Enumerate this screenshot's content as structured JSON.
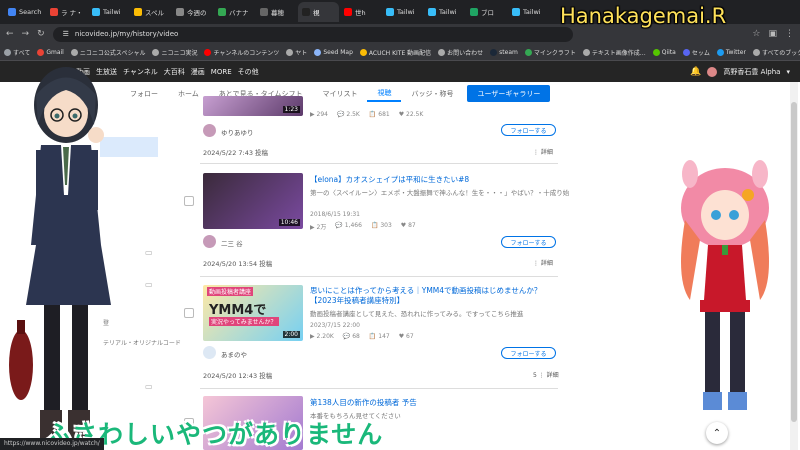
{
  "browser": {
    "tabs": [
      {
        "label": "Search",
        "color": "#4285f4"
      },
      {
        "label": "ラ ナ・",
        "color": "#ea4335"
      },
      {
        "label": "Tailwi",
        "color": "#38bdf8"
      },
      {
        "label": "スペル",
        "color": "#fbbc05"
      },
      {
        "label": "今週の",
        "color": "#888888"
      },
      {
        "label": "バナナ",
        "color": "#34a853"
      },
      {
        "label": "暮穂 ",
        "color": "#666666"
      },
      {
        "label": "視",
        "color": "#222222",
        "active": true
      },
      {
        "label": "世h",
        "color": "#ff0000"
      },
      {
        "label": "Tailwi",
        "color": "#38bdf8"
      },
      {
        "label": "Tailwi",
        "color": "#38bdf8"
      },
      {
        "label": "ブロ",
        "color": "#1fa463"
      },
      {
        "label": "Tailwi",
        "color": "#38bdf8"
      }
    ],
    "url": "nicovideo.jp/my/history/video",
    "bookmarks": [
      {
        "label": "すべて",
        "color": "#9aa0a6"
      },
      {
        "label": "Gmail",
        "color": "#ea4335"
      },
      {
        "label": "ニコニコ公式スペシャル",
        "color": "#aaaaaa"
      },
      {
        "label": "ニコニコ実況",
        "color": "#aaaaaa"
      },
      {
        "label": "チャンネルのコンテンツ",
        "color": "#ff0000"
      },
      {
        "label": "ヤト",
        "color": "#aaaaaa"
      },
      {
        "label": "Seed Map",
        "color": "#8ab4f8"
      },
      {
        "label": "ACUCH KITE 動画配信",
        "color": "#fbbc05"
      },
      {
        "label": "お問い合わせ",
        "color": "#aaaaaa"
      },
      {
        "label": "steam",
        "color": "#1b2838"
      },
      {
        "label": "マインクラフト",
        "color": "#34a853"
      },
      {
        "label": "テキスト画像作成…",
        "color": "#aaaaaa"
      },
      {
        "label": "Qiita",
        "color": "#55c500"
      },
      {
        "label": "セッム",
        "color": "#5865f2"
      },
      {
        "label": "Twitter",
        "color": "#1d9bf0"
      },
      {
        "label": "すべてのブックマーク",
        "color": "#aaaaaa"
      }
    ]
  },
  "site_header": {
    "items": [
      "動画",
      "生放送",
      "チャンネル",
      "大百科",
      "漫画",
      "MORE",
      "その他"
    ],
    "user": "高野香石豊 Alpha"
  },
  "subtabs": {
    "items": [
      "フォロー",
      "ホーム",
      "あとで見る・タイムシフト",
      "マイリスト",
      "視聴"
    ],
    "history_button": "ユーザーギャラリー",
    "last": "バッジ・称号"
  },
  "side_texts": [
    "登",
    "テリアル・オリジナルコード"
  ],
  "feed": {
    "items": [
      {
        "title": "",
        "desc": "",
        "stats": [
          "294",
          "2.5K",
          "681",
          "22.5K"
        ],
        "user": "ゆりあゆり",
        "follow": "フォローする",
        "posted": "2024/5/22 7:43 投稿",
        "more": "⋮ 詳細",
        "duration": "1:23",
        "thumb": [
          "#c79fd1",
          "#5c3a6a"
        ]
      },
      {
        "title": "【elona】カオスシェイプは平和に生きたい#8",
        "desc": "第一の〈スペイルーン〉エメポ・大盤振舞で神ふんな！生を・・・」やばい？・十成り始",
        "uploaded": "2018/6/15 19:31",
        "stats": [
          "2万",
          "1,466",
          "303",
          "87"
        ],
        "user": "二三 谷",
        "follow": "フォローする",
        "posted": "2024/5/20 13:54 投稿",
        "more": "⋮ 詳細",
        "duration": "10:46",
        "thumb": [
          "#3a2a3a",
          "#7a4aa0"
        ]
      },
      {
        "title": "思いにことは作ってから考える｜YMM4で動画投稿はじめませんか？",
        "title2": "【2023年投稿者講座特別】",
        "desc": "動画投稿者講座として見えた、恐れれに作ってみる。ですってこちら推進",
        "uploaded": "2023/7/15 22:00",
        "stats": [
          "2.20K",
          "68",
          "147",
          "67"
        ],
        "user": "あまのや",
        "follow": "フォローする",
        "posted": "2024/5/20 12:43 投稿",
        "more": "5 ⋮ 詳細",
        "duration": "2:00",
        "thumb_text": "YMM4で",
        "thumb_text2": "実況やってみませんか？",
        "thumb_text0": "動画投稿者講座",
        "thumb": [
          "#ffe9a6",
          "#76d0f2"
        ]
      },
      {
        "title": "第138人目の新作の投稿者 予告",
        "desc": "本番をもちろん見せてください",
        "duration": "",
        "thumb": [
          "#f5c6d6",
          "#a37ad1"
        ]
      }
    ]
  },
  "overlay": {
    "watermark": "Hanakagemai.R",
    "subtitle": "ふさわしいやつがありません"
  },
  "status_url": "https://www.nicovideo.jp/watch/"
}
